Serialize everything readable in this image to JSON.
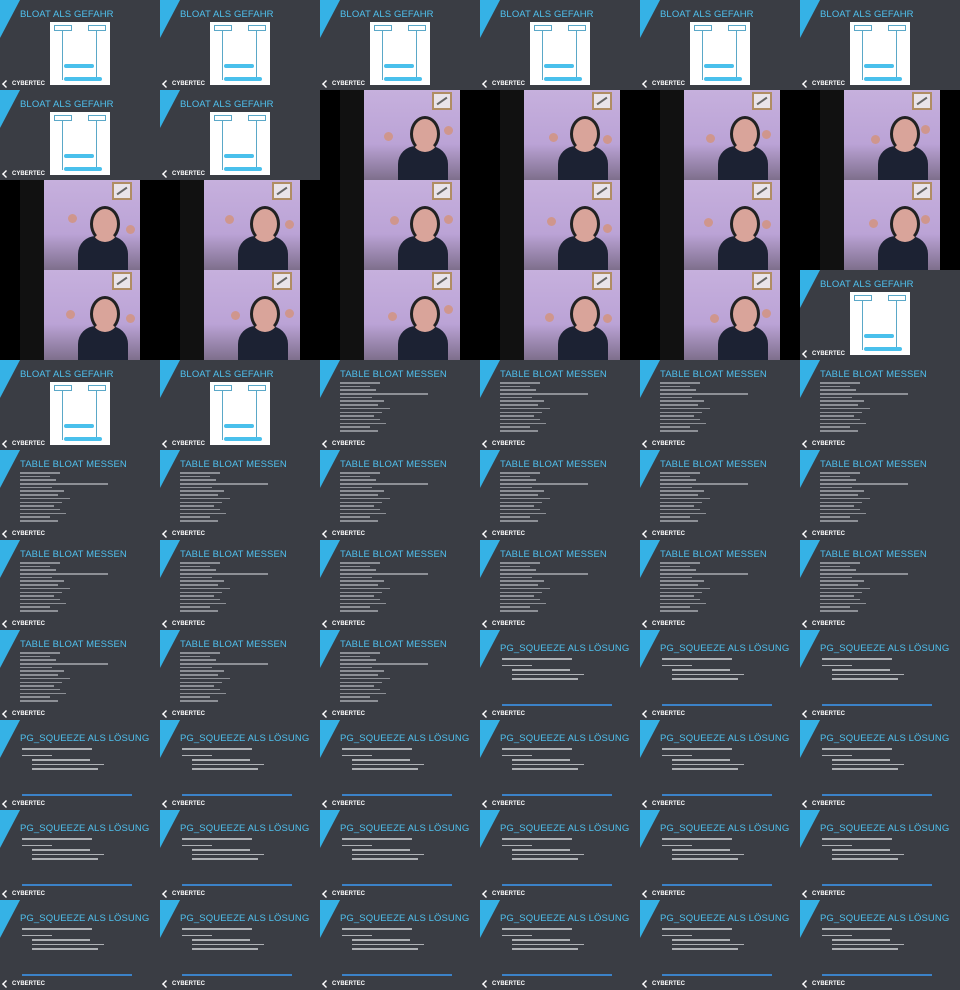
{
  "grid": {
    "cols": 6,
    "rows": 11
  },
  "titles": {
    "bloat": "BLOAT ALS GEFAHR",
    "measure": "TABLE BLOAT MESSEN",
    "squeeze": "PG_SQUEEZE ALS LÖSUNG"
  },
  "logo": "CYBERTEC",
  "tiles": [
    "bloat",
    "bloat",
    "bloat",
    "bloat",
    "bloat",
    "bloat",
    "bloat",
    "bloat",
    "video",
    "video",
    "video",
    "video",
    "video",
    "video",
    "video",
    "video",
    "video",
    "video",
    "video",
    "video",
    "video",
    "video",
    "video",
    "bloat",
    "bloat",
    "bloat",
    "measure",
    "measure",
    "measure",
    "measure",
    "measure",
    "measure",
    "measure",
    "measure",
    "measure",
    "measure",
    "measure",
    "measure",
    "measure",
    "measure",
    "measure",
    "measure",
    "measure",
    "measure",
    "measure",
    "squeeze",
    "squeeze",
    "squeeze",
    "squeeze",
    "squeeze",
    "squeeze",
    "squeeze",
    "squeeze",
    "squeeze",
    "squeeze",
    "squeeze",
    "squeeze",
    "squeeze",
    "squeeze",
    "squeeze",
    "squeeze",
    "squeeze",
    "squeeze",
    "squeeze",
    "squeeze",
    "squeeze"
  ]
}
